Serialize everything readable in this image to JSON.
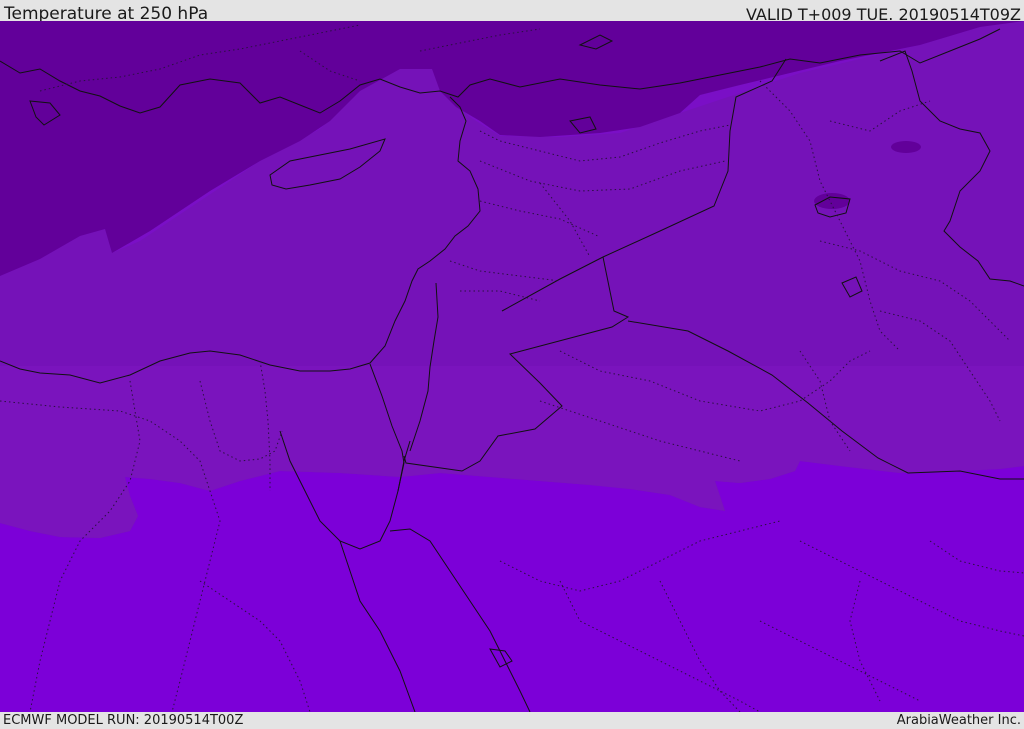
{
  "header": {
    "title": "Temperature at 250 hPa",
    "valid": "VALID T+009 TUE. 20190514T09Z"
  },
  "footer": {
    "model_run": "ECMWF MODEL RUN: 20190514T00Z",
    "credit": "ArabiaWeather Inc."
  },
  "map": {
    "colors": {
      "coldest_band": "#62009a",
      "mid_band": "#7510b8",
      "south_band": "#7a0fc6",
      "warmest_band": "#7c00d8",
      "borders": "#111111"
    }
  }
}
